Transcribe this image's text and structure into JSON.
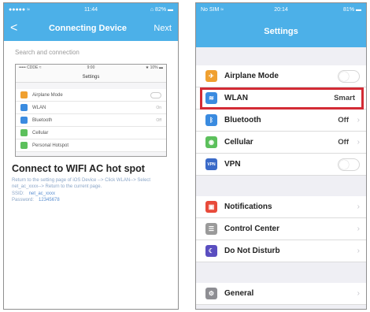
{
  "left": {
    "status": {
      "left": "●●●●● ≈",
      "center": "11:44",
      "right": "⌂ 82% ▬"
    },
    "nav": {
      "back": "<",
      "title": "Connecting Device",
      "next": "Next"
    },
    "search_hint": "Search and connection",
    "mini": {
      "status": {
        "left": "••••• CDDE ≈",
        "center": "9:00",
        "right": "★ 10% ▬"
      },
      "title": "Settings",
      "rows": [
        {
          "label": "Airplane Mode",
          "value": "",
          "toggle": true,
          "color": "#f0a030"
        },
        {
          "label": "WLAN",
          "value": "On",
          "toggle": false,
          "color": "#3a8be0"
        },
        {
          "label": "Bluetooth",
          "value": "Off",
          "toggle": false,
          "color": "#3a8be0"
        },
        {
          "label": "Cellular",
          "value": "",
          "toggle": false,
          "color": "#5cc05c"
        },
        {
          "label": "Personal Hotspot",
          "value": "",
          "toggle": false,
          "color": "#5cc05c"
        }
      ]
    },
    "hotspot_title": "Connect to WIFI AC hot spot",
    "hotspot_desc": "Return to the setting page of iOS Device --> Click WLAN--> Select net_ac_xxxx--> Return to the current page.",
    "ssid_label": "SSID:",
    "ssid_value": "net_ac_xxxx",
    "password_label": "Password:",
    "password_value": "12345678"
  },
  "right": {
    "status": {
      "left": "No SIM ≈",
      "center": "20:14",
      "right": "81% ▬"
    },
    "title": "Settings",
    "group1": [
      {
        "label": "Airplane Mode",
        "value": "",
        "toggle": true,
        "icon": "airplane-icon",
        "glyph": "✈",
        "color": "#f0a030"
      },
      {
        "label": "WLAN",
        "value": "Smart",
        "toggle": false,
        "chevron": false,
        "icon": "wifi-icon",
        "glyph": "≋",
        "color": "#3a8be0"
      },
      {
        "label": "Bluetooth",
        "value": "Off",
        "toggle": false,
        "chevron": true,
        "icon": "bluetooth-icon",
        "glyph": "ᛒ",
        "color": "#3a8be0"
      },
      {
        "label": "Cellular",
        "value": "Off",
        "toggle": false,
        "chevron": true,
        "icon": "cellular-icon",
        "glyph": "◉",
        "color": "#5cc05c"
      },
      {
        "label": "VPN",
        "value": "",
        "toggle": true,
        "icon": "vpn-icon",
        "glyph": "VPN",
        "color": "#3a6ac8"
      }
    ],
    "group2": [
      {
        "label": "Notifications",
        "icon": "notifications-icon",
        "glyph": "▣",
        "color": "#e84a3a"
      },
      {
        "label": "Control Center",
        "icon": "control-center-icon",
        "glyph": "☰",
        "color": "#9a9a9a"
      },
      {
        "label": "Do Not Disturb",
        "icon": "do-not-disturb-icon",
        "glyph": "☾",
        "color": "#5a4ec0"
      }
    ],
    "group3": [
      {
        "label": "General",
        "icon": "gear-icon",
        "glyph": "⚙",
        "color": "#8e8e93"
      }
    ]
  }
}
